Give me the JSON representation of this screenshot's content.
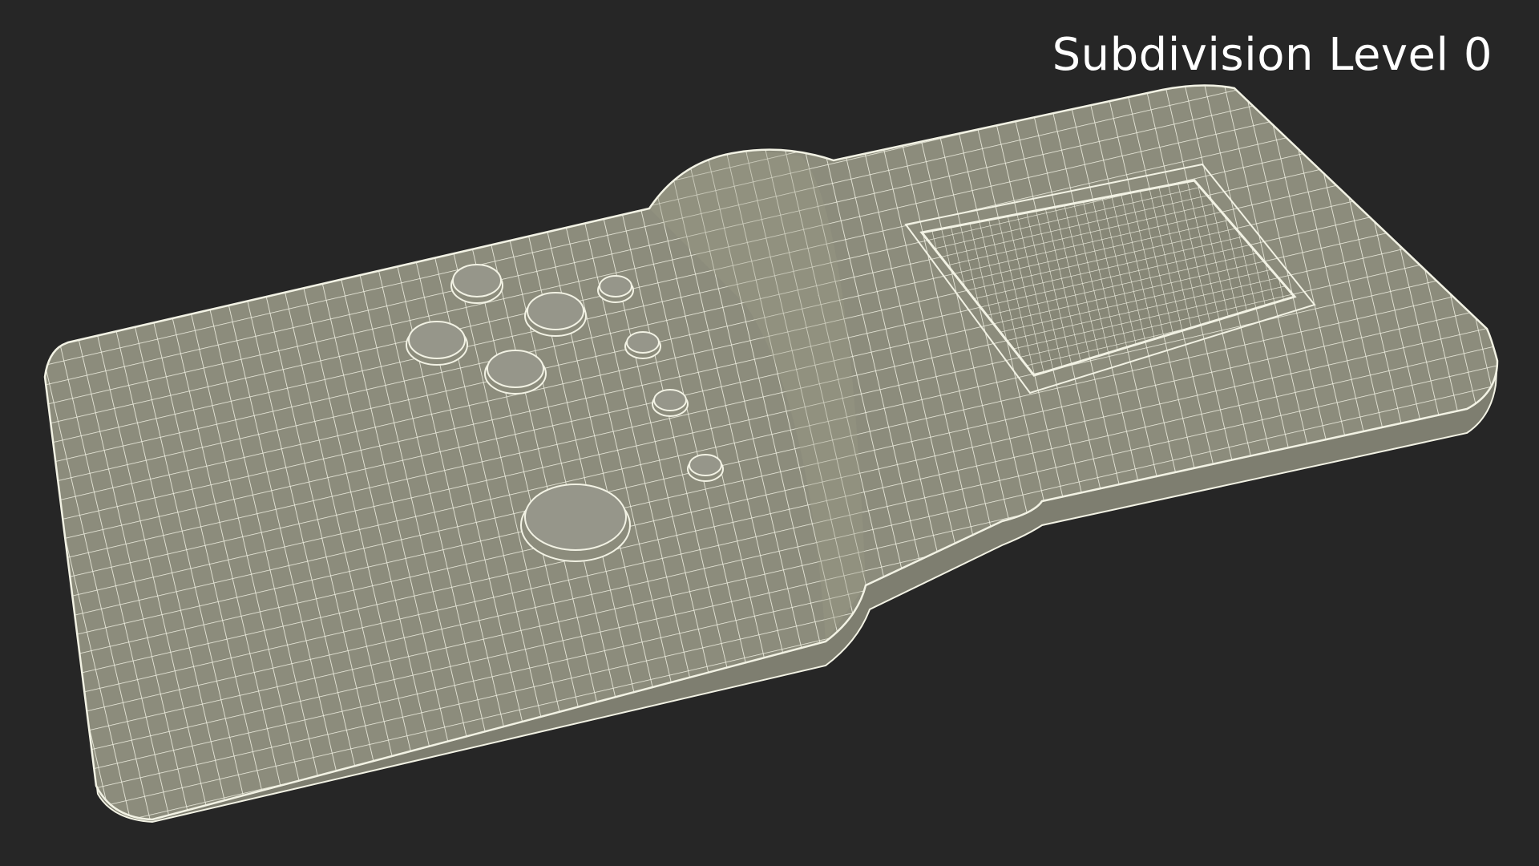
{
  "viewport": {
    "label": "Subdivision Level 0",
    "background_color": "#262626",
    "surface_color": "#8c8c7c",
    "wire_color": "#f2f2e4"
  },
  "model": {
    "object": "handheld-game-console-wireframe",
    "buttons": 9,
    "screen": 1
  }
}
